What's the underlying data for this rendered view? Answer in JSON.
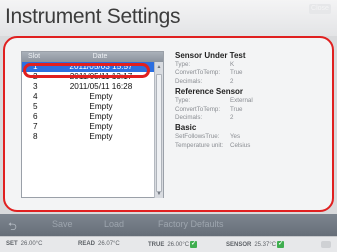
{
  "window": {
    "title": "Instrument Settings",
    "close_label": "Close"
  },
  "list": {
    "headers": {
      "slot": "Slot",
      "date": "Date"
    },
    "rows": [
      {
        "slot": "1",
        "date": "2011/05/03 15:57",
        "selected": true
      },
      {
        "slot": "2",
        "date": "2011/05/11 13:17"
      },
      {
        "slot": "3",
        "date": "2011/05/11 16:28"
      },
      {
        "slot": "4",
        "date": "Empty"
      },
      {
        "slot": "5",
        "date": "Empty"
      },
      {
        "slot": "6",
        "date": "Empty"
      },
      {
        "slot": "7",
        "date": "Empty"
      },
      {
        "slot": "8",
        "date": "Empty"
      }
    ]
  },
  "details": {
    "sensor_under_test": {
      "title": "Sensor Under Test",
      "items": [
        {
          "k": "Type:",
          "v": "K"
        },
        {
          "k": "ConvertToTemp:",
          "v": "True"
        },
        {
          "k": "Decimals:",
          "v": "2"
        }
      ]
    },
    "reference_sensor": {
      "title": "Reference Sensor",
      "items": [
        {
          "k": "Type:",
          "v": "External"
        },
        {
          "k": "ConvertToTemp:",
          "v": "True"
        },
        {
          "k": "Decimals:",
          "v": "2"
        }
      ]
    },
    "basic": {
      "title": "Basic",
      "items": [
        {
          "k": "SetFollowsTrue:",
          "v": "Yes"
        },
        {
          "k": "Temperature unit:",
          "v": "Celsius"
        }
      ]
    }
  },
  "toolbar": {
    "save_label": "Save",
    "load_label": "Load",
    "factory_label": "Factory Defaults"
  },
  "status": {
    "set": {
      "label": "SET",
      "value": "26.00°C"
    },
    "read": {
      "label": "READ",
      "value": "26.07°C"
    },
    "true": {
      "label": "TRUE",
      "value": "26.00°C"
    },
    "sensor": {
      "label": "SENSOR",
      "value": "25.37°C"
    }
  },
  "colors": {
    "highlight_ring": "#e02020",
    "selection": "#2c6fe0",
    "ok_check": "#3fae4f"
  }
}
